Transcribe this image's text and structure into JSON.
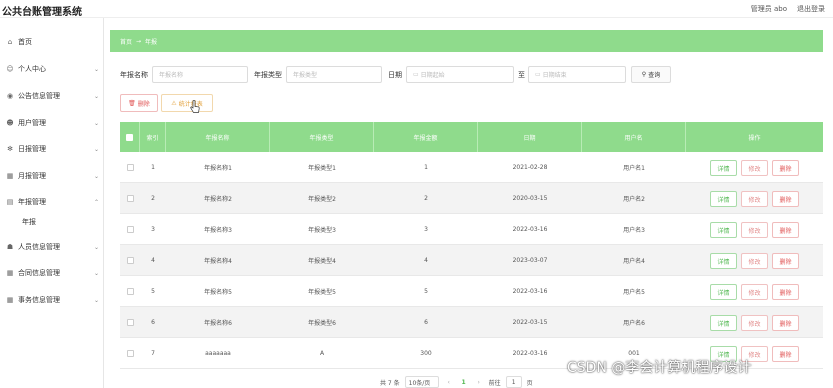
{
  "app": {
    "title": "公共台账管理系统",
    "user_label": "管理员",
    "username": "abo",
    "logout": "退出登录"
  },
  "sidebar": {
    "items": [
      {
        "label": "首页",
        "icon": "home-icon",
        "glyph": "⌂"
      },
      {
        "label": "个人中心",
        "icon": "user-icon",
        "glyph": "☺"
      },
      {
        "label": "公告信息管理",
        "icon": "megaphone-icon",
        "glyph": "◉"
      },
      {
        "label": "用户管理",
        "icon": "users-icon",
        "glyph": "☻"
      },
      {
        "label": "日报管理",
        "icon": "gear-icon",
        "glyph": "✻"
      },
      {
        "label": "月报管理",
        "icon": "grid-icon",
        "glyph": "▦"
      },
      {
        "label": "年报管理",
        "icon": "report-icon",
        "glyph": "▤"
      },
      {
        "label": "人员信息管理",
        "icon": "person-icon",
        "glyph": "☗"
      },
      {
        "label": "合同信息管理",
        "icon": "grid-icon",
        "glyph": "▦"
      },
      {
        "label": "事务信息管理",
        "icon": "grid-icon",
        "glyph": "▦"
      }
    ],
    "sub_item": "年报"
  },
  "breadcrumb": {
    "home": "首页",
    "current": "年报"
  },
  "filters": {
    "name_label": "年报名称",
    "name_placeholder": "年报名称",
    "type_label": "年报类型",
    "type_placeholder": "年报类型",
    "date_label": "日期",
    "date_start_placeholder": "日期起始",
    "date_to": "至",
    "date_end_placeholder": "日期结束",
    "query_label": "查询"
  },
  "actions": {
    "delete_label": "删除",
    "stats_label": "统计报表"
  },
  "table": {
    "headers": [
      "索引",
      "年报名称",
      "年报类型",
      "年报金额",
      "日期",
      "用户名",
      "操作"
    ],
    "rows": [
      {
        "index": "1",
        "name": "年报名称1",
        "type": "年报类型1",
        "amount": "1",
        "date": "2021-02-28",
        "user": "用户名1"
      },
      {
        "index": "2",
        "name": "年报名称2",
        "type": "年报类型2",
        "amount": "2",
        "date": "2020-03-15",
        "user": "用户名2"
      },
      {
        "index": "3",
        "name": "年报名称3",
        "type": "年报类型3",
        "amount": "3",
        "date": "2022-03-16",
        "user": "用户名3"
      },
      {
        "index": "4",
        "name": "年报名称4",
        "type": "年报类型4",
        "amount": "4",
        "date": "2023-03-07",
        "user": "用户名4"
      },
      {
        "index": "5",
        "name": "年报名称5",
        "type": "年报类型5",
        "amount": "5",
        "date": "2022-03-16",
        "user": "用户名5"
      },
      {
        "index": "6",
        "name": "年报名称6",
        "type": "年报类型6",
        "amount": "6",
        "date": "2022-03-15",
        "user": "用户名6"
      },
      {
        "index": "7",
        "name": "aaaaaaa",
        "type": "A",
        "amount": "300",
        "date": "2022-03-16",
        "user": "001"
      }
    ],
    "op_detail": "详情",
    "op_edit": "修改",
    "op_delete": "删除"
  },
  "pagination": {
    "total": "共 7 条",
    "page_size": "10条/页",
    "prev": "‹",
    "current": "1",
    "next": "›",
    "goto_label": "前往",
    "goto_value": "1",
    "page_suffix": "页"
  },
  "watermark": "CSDN @李会计算机程序设计",
  "colors": {
    "accent": "#8fdb8c",
    "danger": "#e05555",
    "warning": "#e2a13c",
    "success": "#52b852"
  }
}
